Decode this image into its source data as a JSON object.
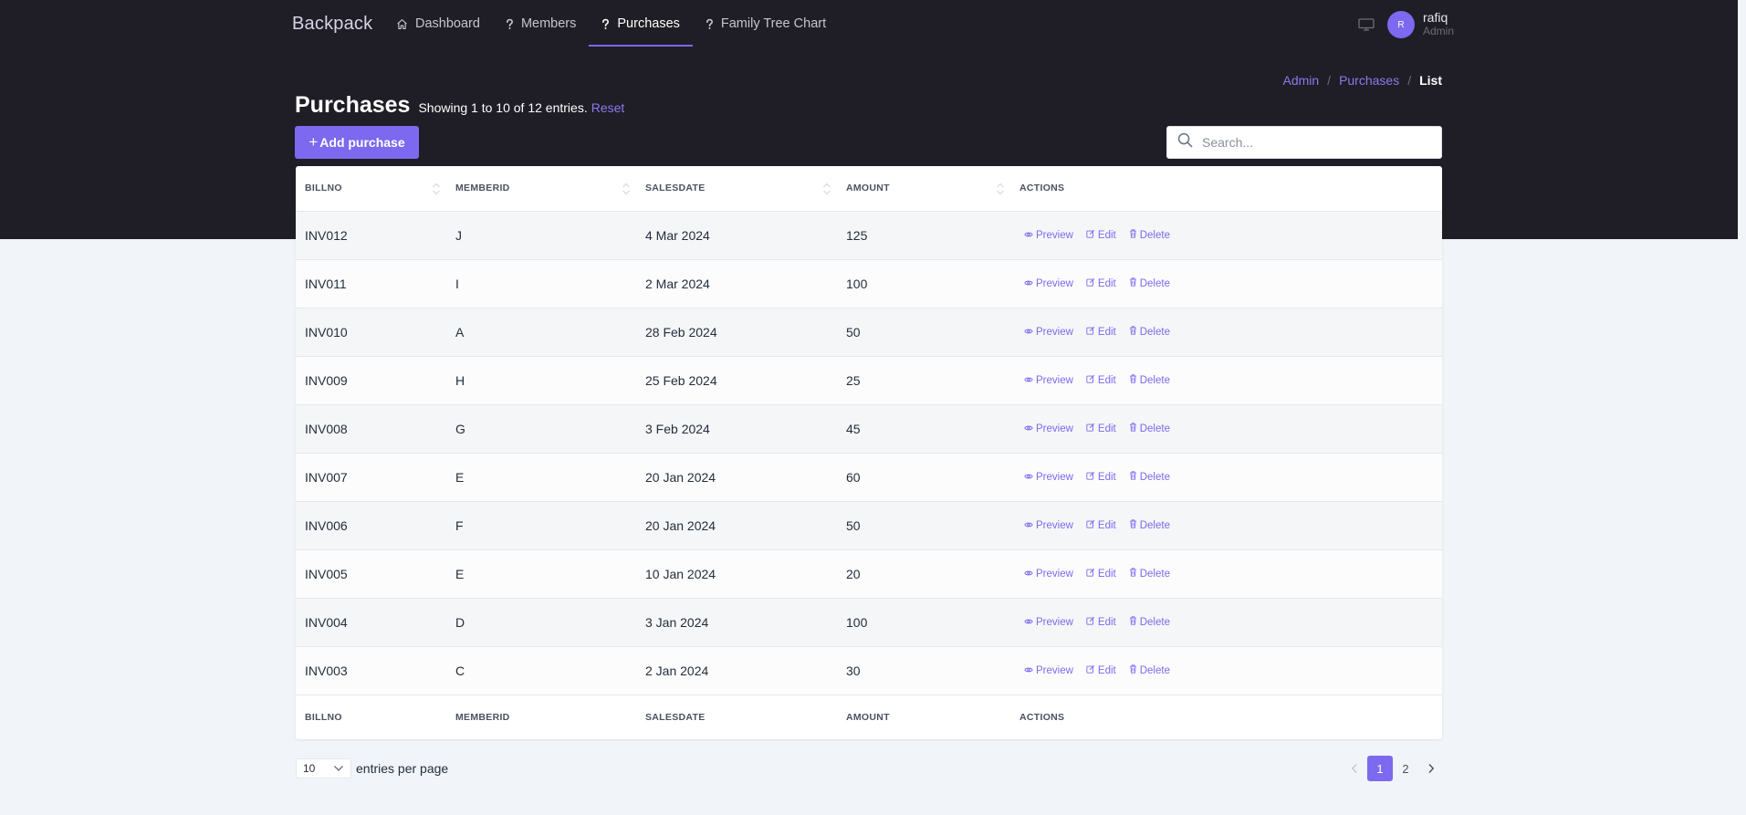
{
  "brand": "Backpack",
  "nav": [
    {
      "label": "Dashboard",
      "icon": "home-icon"
    },
    {
      "label": "Members",
      "icon": "question-icon"
    },
    {
      "label": "Purchases",
      "icon": "question-icon",
      "active": true
    },
    {
      "label": "Family Tree Chart",
      "icon": "question-icon"
    }
  ],
  "user": {
    "initial": "R",
    "name": "rafiq",
    "role": "Admin"
  },
  "breadcrumb": {
    "admin": "Admin",
    "purchases": "Purchases",
    "current": "List",
    "sep": "/"
  },
  "header": {
    "title": "Purchases",
    "subtitle": "Showing 1 to 10 of 12 entries.",
    "reset": "Reset",
    "add_button": "Add purchase",
    "search_placeholder": "Search..."
  },
  "table": {
    "columns": [
      "Billno",
      "MemberID",
      "SalesDate",
      "Amount",
      "Actions"
    ],
    "actions": {
      "preview": "Preview",
      "edit": "Edit",
      "delete": "Delete"
    },
    "rows": [
      {
        "billno": "INV012",
        "memberid": "J",
        "salesdate": "4 Mar 2024",
        "amount": "125"
      },
      {
        "billno": "INV011",
        "memberid": "I",
        "salesdate": "2 Mar 2024",
        "amount": "100"
      },
      {
        "billno": "INV010",
        "memberid": "A",
        "salesdate": "28 Feb 2024",
        "amount": "50"
      },
      {
        "billno": "INV009",
        "memberid": "H",
        "salesdate": "25 Feb 2024",
        "amount": "25"
      },
      {
        "billno": "INV008",
        "memberid": "G",
        "salesdate": "3 Feb 2024",
        "amount": "45"
      },
      {
        "billno": "INV007",
        "memberid": "E",
        "salesdate": "20 Jan 2024",
        "amount": "60"
      },
      {
        "billno": "INV006",
        "memberid": "F",
        "salesdate": "20 Jan 2024",
        "amount": "50"
      },
      {
        "billno": "INV005",
        "memberid": "E",
        "salesdate": "10 Jan 2024",
        "amount": "20"
      },
      {
        "billno": "INV004",
        "memberid": "D",
        "salesdate": "3 Jan 2024",
        "amount": "100"
      },
      {
        "billno": "INV003",
        "memberid": "C",
        "salesdate": "2 Jan 2024",
        "amount": "30"
      }
    ]
  },
  "footer": {
    "per_page_value": "10",
    "per_page_label": "entries per page",
    "pages": [
      "1",
      "2"
    ],
    "current_page": "1"
  },
  "colors": {
    "accent": "#7c69ef",
    "dark": "#1f1d25",
    "background": "#f1f4f8"
  }
}
